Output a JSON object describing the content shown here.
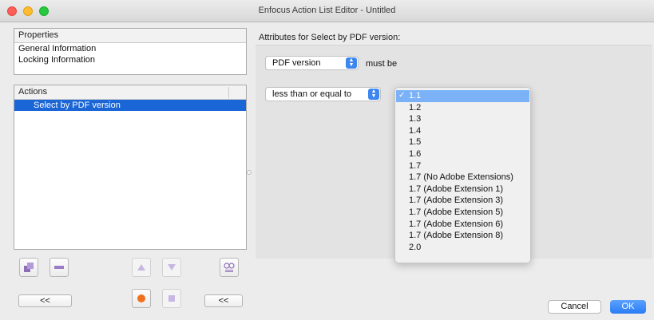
{
  "window": {
    "title": "Enfocus Action List Editor - Untitled"
  },
  "properties": {
    "header": "Properties",
    "items": [
      "General Information",
      "Locking Information"
    ]
  },
  "actions": {
    "header": "Actions",
    "items": [
      {
        "label": "Select by PDF version",
        "selected": true
      }
    ]
  },
  "toolbar": {
    "left_back_label": "<<",
    "right_back_label": "<<"
  },
  "attributes": {
    "heading": "Attributes for Select by PDF version:",
    "field_select": "PDF version",
    "must_be": "must be",
    "comparison_select": "less than or equal to",
    "version_options": [
      "1.1",
      "1.2",
      "1.3",
      "1.4",
      "1.5",
      "1.6",
      "1.7",
      "1.7 (No Adobe Extensions)",
      "1.7 (Adobe Extension 1)",
      "1.7 (Adobe Extension 3)",
      "1.7 (Adobe Extension 5)",
      "1.7 (Adobe Extension 6)",
      "1.7 (Adobe Extension 8)",
      "2.0"
    ],
    "selected_version": "1.1"
  },
  "dialog": {
    "cancel_label": "Cancel",
    "ok_label": "OK"
  },
  "colors": {
    "accent": "#1b66d6",
    "menu_highlight": "#7bb1f7",
    "ok_button": "#2a7cf5"
  }
}
